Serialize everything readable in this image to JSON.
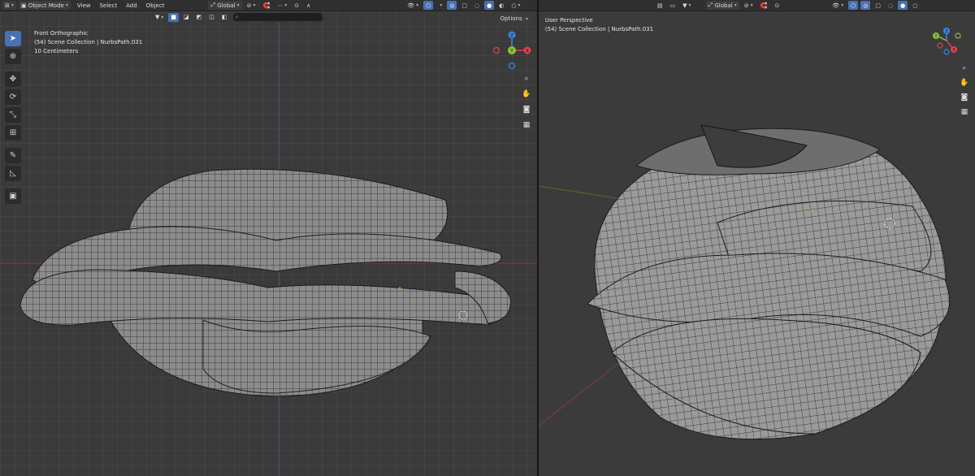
{
  "left_viewport": {
    "header": {
      "mode_label": "Object Mode",
      "menus": [
        "View",
        "Select",
        "Add",
        "Object"
      ],
      "transform_orientation": "Global",
      "options_label": "Options"
    },
    "info": {
      "view_name": "Front Orthographic",
      "collection": "(54) Scene Collection | NurbsPath.031",
      "scale": "10 Centimeters"
    },
    "tools": [
      "select-box",
      "cursor",
      "move",
      "rotate",
      "scale",
      "transform",
      "annotate",
      "measure",
      "add-cube"
    ]
  },
  "right_viewport": {
    "header": {
      "transform_orientation": "Global"
    },
    "info": {
      "view_name": "User Perspective",
      "collection": "(54) Scene Collection | NurbsPath.031"
    }
  },
  "gizmo_axes": {
    "x": "X",
    "y": "Y",
    "z": "Z"
  },
  "colors": {
    "x_axis": "#e04050",
    "y_axis": "#8ac43a",
    "z_axis": "#3b86e6",
    "accent": "#4772b3",
    "mesh_fill": "#8a8a8a",
    "wire": "#1e1e1e"
  }
}
